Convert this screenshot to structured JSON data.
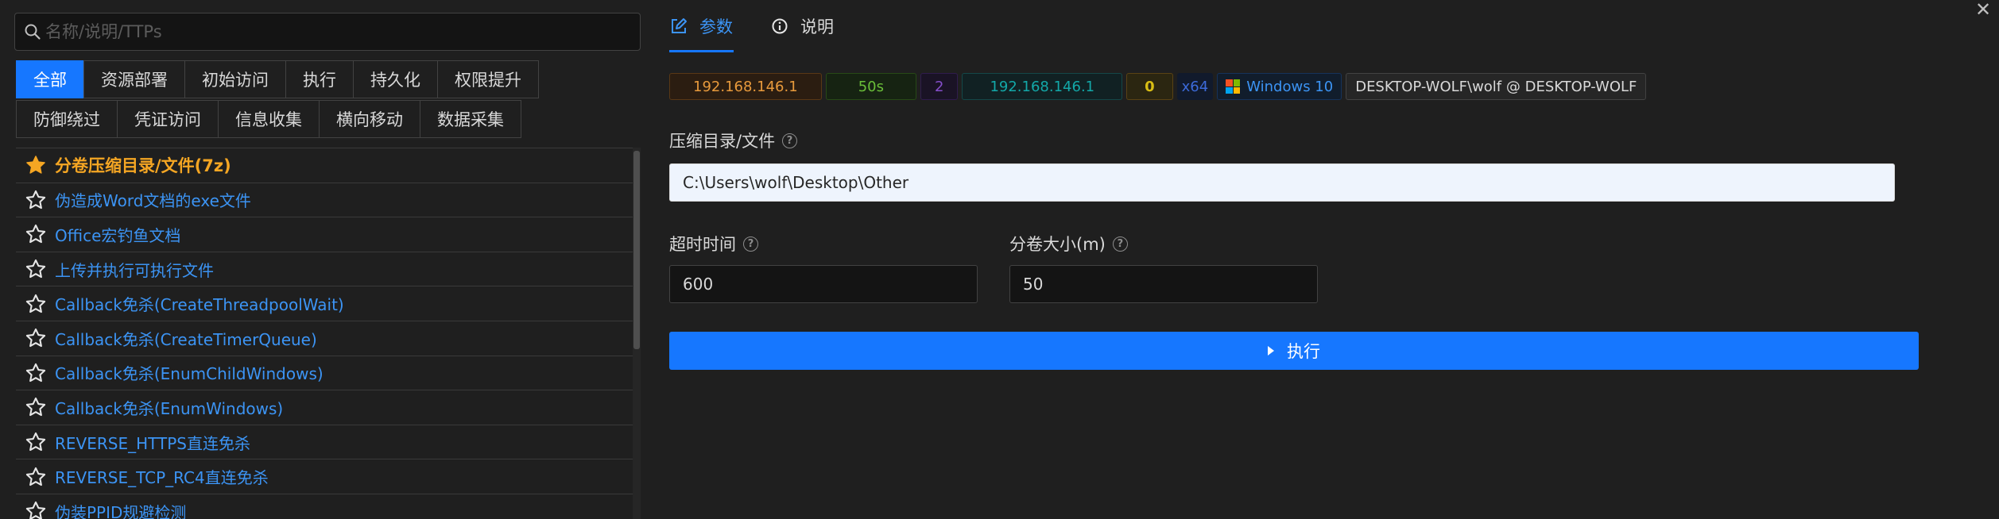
{
  "search": {
    "placeholder": "名称/说明/TTPs"
  },
  "category_tabs": {
    "row1": [
      "全部",
      "资源部署",
      "初始访问",
      "执行",
      "持久化",
      "权限提升"
    ],
    "row2": [
      "防御绕过",
      "凭证访问",
      "信息收集",
      "横向移动",
      "数据采集"
    ],
    "active": "全部"
  },
  "modules": [
    {
      "label": "分卷压缩目录/文件(7z)",
      "starred": true
    },
    {
      "label": "伪造成Word文档的exe文件",
      "starred": false
    },
    {
      "label": "Office宏钓鱼文档",
      "starred": false
    },
    {
      "label": "上传并执行可执行文件",
      "starred": false
    },
    {
      "label": "Callback免杀(CreateThreadpoolWait)",
      "starred": false
    },
    {
      "label": "Callback免杀(CreateTimerQueue)",
      "starred": false
    },
    {
      "label": "Callback免杀(EnumChildWindows)",
      "starred": false
    },
    {
      "label": "Callback免杀(EnumWindows)",
      "starred": false
    },
    {
      "label": "REVERSE_HTTPS直连免杀",
      "starred": false
    },
    {
      "label": "REVERSE_TCP_RC4直连免杀",
      "starred": false
    },
    {
      "label": "伪装PPID规避检测",
      "starred": false
    }
  ],
  "top_tabs": {
    "params": "参数",
    "help": "说明",
    "active": "参数"
  },
  "session": {
    "ip": "192.168.146.1",
    "heartbeat": "50s",
    "pid": "2",
    "internal_ip": "192.168.146.1",
    "count": "0",
    "arch": "x64",
    "os": "Windows 10",
    "host": "DESKTOP-WOLF\\wolf @ DESKTOP-WOLF"
  },
  "form": {
    "path_label": "压缩目录/文件",
    "path_value": "C:\\Users\\wolf\\Desktop\\Other",
    "timeout_label": "超时时间",
    "timeout_value": "600",
    "volume_label": "分卷大小(m)",
    "volume_value": "50"
  },
  "execute_label": "执行",
  "colors": {
    "accent": "#1677ff",
    "link": "#3c94f4",
    "favorite": "#f5a623"
  }
}
